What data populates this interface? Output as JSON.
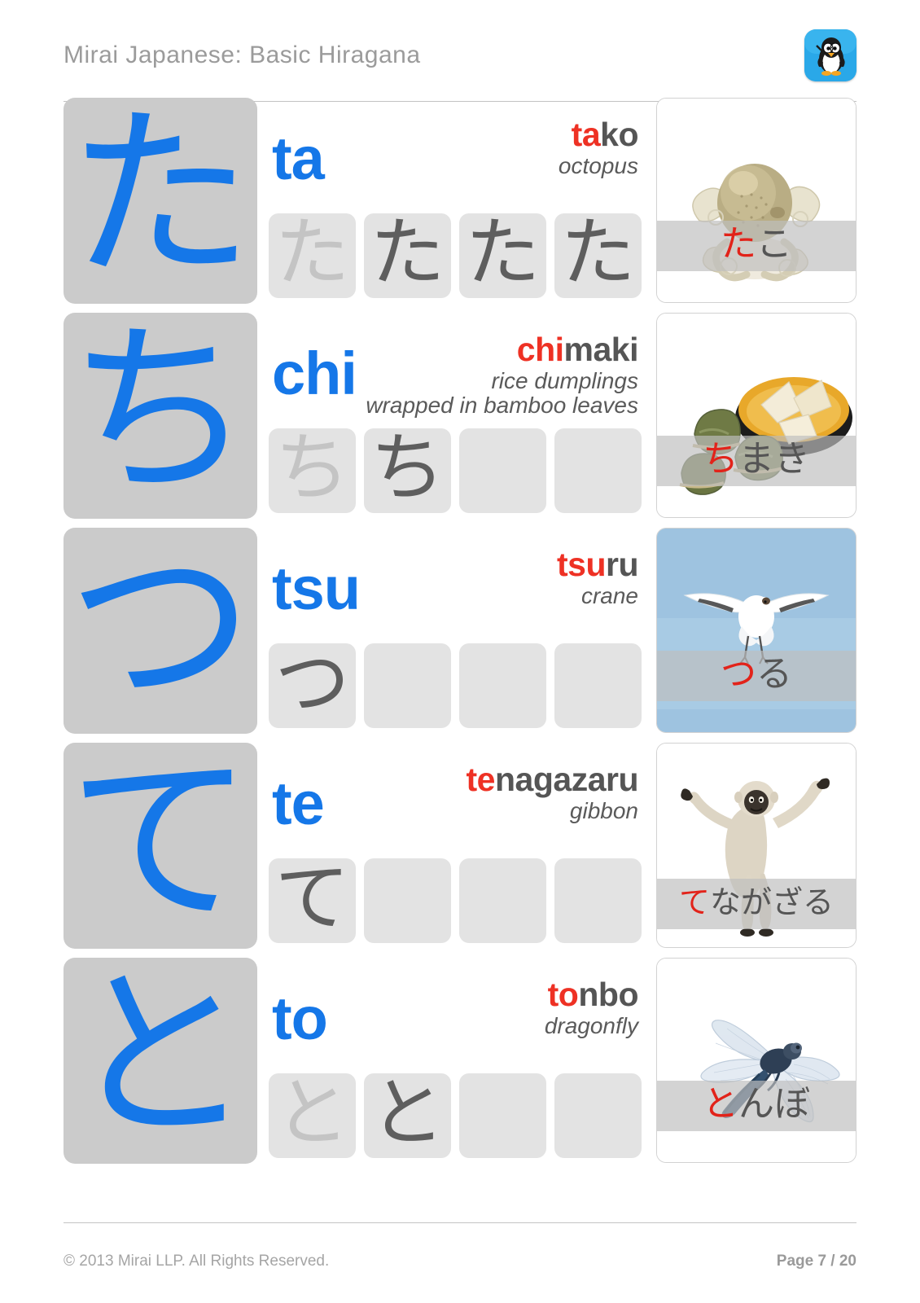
{
  "header": {
    "title": "Mirai Japanese: Basic Hiragana",
    "logo_icon": "penguin-teacher-icon"
  },
  "colors": {
    "character_blue": "#1577e8",
    "highlight_red": "#ee3124",
    "text_gray": "#555555",
    "tile_gray": "#cbcbcb",
    "cell_gray": "#e3e3e3"
  },
  "rows": [
    {
      "kana": "た",
      "romaji": "ta",
      "practice": [
        {
          "kana": "た",
          "ink": 1
        },
        {
          "kana": "た",
          "ink": 2
        },
        {
          "kana": "た",
          "ink": 2
        },
        {
          "kana": "た",
          "ink": 2
        }
      ],
      "vocab": {
        "word_highlight": "ta",
        "word_rest": "ko",
        "meaning_line1": "octopus",
        "meaning_line2": ""
      },
      "card": {
        "image": "octopus-photo",
        "kana_highlight": "た",
        "kana_rest": "こ",
        "background": "#ffffff"
      }
    },
    {
      "kana": "ち",
      "romaji": "chi",
      "practice": [
        {
          "kana": "ち",
          "ink": 1
        },
        {
          "kana": "ち",
          "ink": 2
        },
        {
          "kana": "",
          "ink": 0
        },
        {
          "kana": "",
          "ink": 0
        }
      ],
      "vocab": {
        "word_highlight": "chi",
        "word_rest": "maki",
        "meaning_line1": "rice dumplings",
        "meaning_line2": "wrapped in bamboo leaves"
      },
      "card": {
        "image": "chimaki-dumplings-photo",
        "kana_highlight": "ち",
        "kana_rest": "まき",
        "background": "#ffffff"
      }
    },
    {
      "kana": "つ",
      "romaji": "tsu",
      "practice": [
        {
          "kana": "つ",
          "ink": 2
        },
        {
          "kana": "",
          "ink": 0
        },
        {
          "kana": "",
          "ink": 0
        },
        {
          "kana": "",
          "ink": 0
        }
      ],
      "vocab": {
        "word_highlight": "tsu",
        "word_rest": "ru",
        "meaning_line1": "crane",
        "meaning_line2": ""
      },
      "card": {
        "image": "crane-bird-photo",
        "kana_highlight": "つ",
        "kana_rest": "る",
        "background": "#a8cbe4"
      }
    },
    {
      "kana": "て",
      "romaji": "te",
      "practice": [
        {
          "kana": "て",
          "ink": 2
        },
        {
          "kana": "",
          "ink": 0
        },
        {
          "kana": "",
          "ink": 0
        },
        {
          "kana": "",
          "ink": 0
        }
      ],
      "vocab": {
        "word_highlight": "te",
        "word_rest": "nagazaru",
        "meaning_line1": "gibbon",
        "meaning_line2": ""
      },
      "card": {
        "image": "gibbon-monkey-photo",
        "kana_highlight": "て",
        "kana_rest": "ながざる",
        "background": "#ffffff"
      }
    },
    {
      "kana": "と",
      "romaji": "to",
      "practice": [
        {
          "kana": "と",
          "ink": 1
        },
        {
          "kana": "と",
          "ink": 2
        },
        {
          "kana": "",
          "ink": 0
        },
        {
          "kana": "",
          "ink": 0
        }
      ],
      "vocab": {
        "word_highlight": "to",
        "word_rest": "nbo",
        "meaning_line1": "dragonfly",
        "meaning_line2": ""
      },
      "card": {
        "image": "dragonfly-photo",
        "kana_highlight": "と",
        "kana_rest": "んぼ",
        "background": "#ffffff"
      }
    }
  ],
  "footer": {
    "copyright": "© 2013 Mirai LLP. All Rights Reserved.",
    "page": "Page 7 / 20"
  }
}
